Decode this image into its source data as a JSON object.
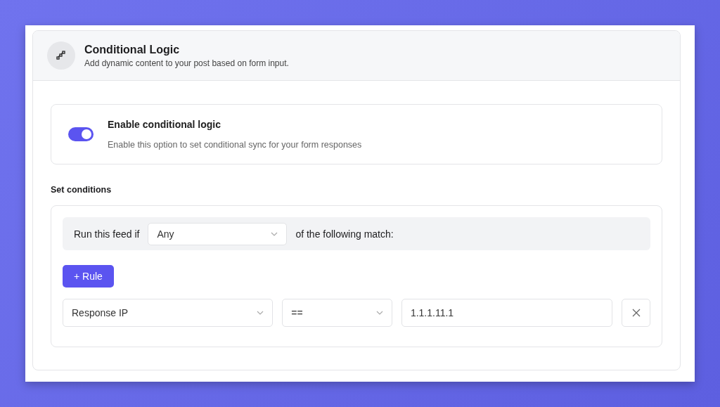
{
  "header": {
    "title": "Conditional Logic",
    "subtitle": "Add dynamic content to your post based on form input."
  },
  "toggle": {
    "label": "Enable conditional logic",
    "description": "Enable this option to set conditional sync for your form responses",
    "on": true
  },
  "section_title": "Set conditions",
  "match": {
    "prefix": "Run this feed if",
    "value": "Any",
    "suffix": "of the following match:"
  },
  "add_rule_button": "+ Rule",
  "rules": [
    {
      "field": "Response IP",
      "operator": "==",
      "value": "1.1.1.11.1"
    }
  ]
}
